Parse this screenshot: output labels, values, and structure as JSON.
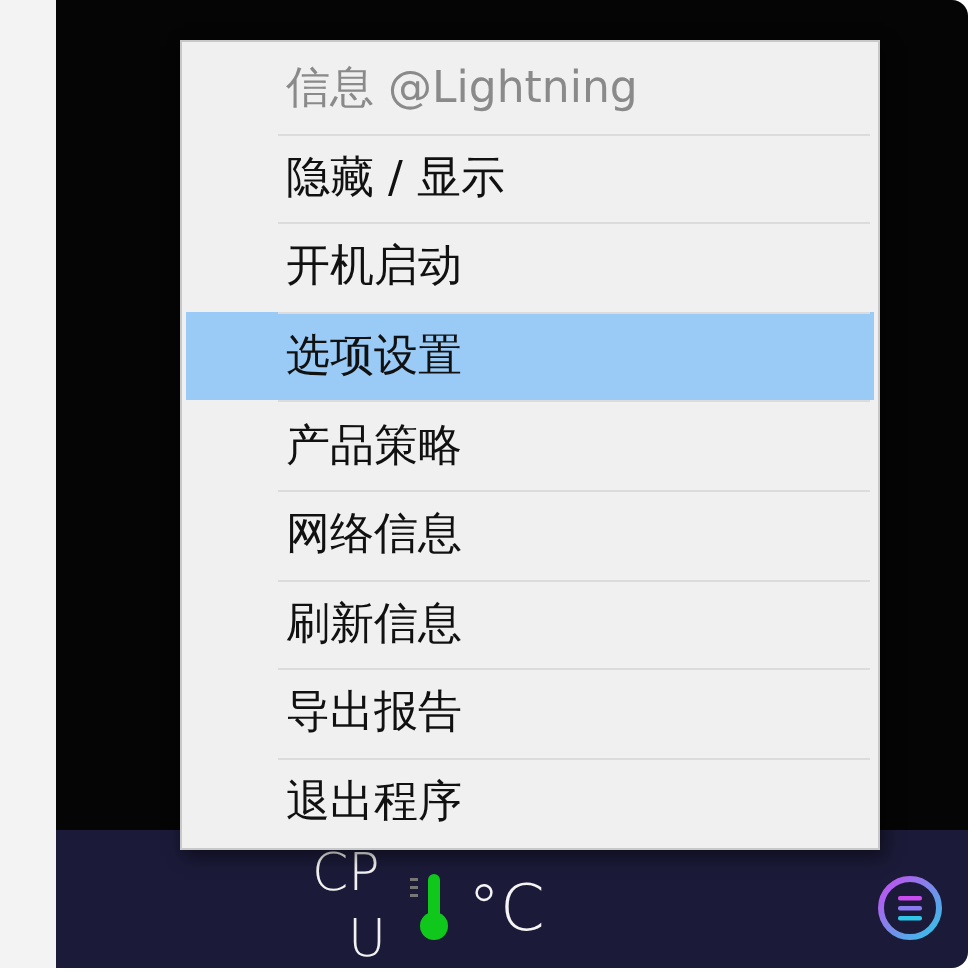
{
  "menu": {
    "items": [
      {
        "label": "信息  @Lightning",
        "disabled": true,
        "selected": false
      },
      {
        "label": "隐藏 / 显示",
        "disabled": false,
        "selected": false
      },
      {
        "label": "开机启动",
        "disabled": false,
        "selected": false
      },
      {
        "label": "选项设置",
        "disabled": false,
        "selected": true
      },
      {
        "label": "产品策略",
        "disabled": false,
        "selected": false
      },
      {
        "label": "网络信息",
        "disabled": false,
        "selected": false
      },
      {
        "label": "刷新信息",
        "disabled": false,
        "selected": false
      },
      {
        "label": "导出报告",
        "disabled": false,
        "selected": false
      },
      {
        "label": "退出程序",
        "disabled": false,
        "selected": false
      }
    ]
  },
  "taskbar": {
    "cpu_label_top": "CP",
    "cpu_label_bottom": "U",
    "unit": "°C"
  }
}
